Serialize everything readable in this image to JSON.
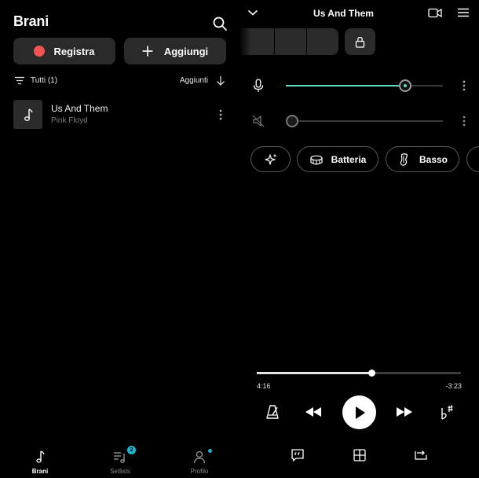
{
  "left": {
    "title": "Brani",
    "record_label": "Registra",
    "add_label": "Aggiungi",
    "filter_label": "Tutti (1)",
    "sort_label": "Aggiunti",
    "songs": [
      {
        "title": "Us And Them",
        "artist": "Pink Floyd"
      }
    ],
    "nav": {
      "brani_label": "Brani",
      "setlists_label": "Setlists",
      "setlists_badge": "2",
      "profilo_label": "Profilo"
    }
  },
  "player": {
    "title": "Us And Them",
    "mic_level": 0.76,
    "muted_track_level": 0.04,
    "chips": {
      "drums_label": "Batteria",
      "bass_label": "Basso"
    },
    "position_fraction": 0.56,
    "time_elapsed": "4:16",
    "time_remaining": "-3:23"
  },
  "colors": {
    "accent": "#5ee0c0",
    "record": "#f25353",
    "badge": "#19b6d4",
    "surface": "#2b2b2b",
    "background": "#000000"
  },
  "icons": [
    "search-icon",
    "plus-icon",
    "filter-icon",
    "arrow-down-icon",
    "music-note-icon",
    "more-vert-icon",
    "chevron-down-icon",
    "video-camera-icon",
    "hamburger-menu-icon",
    "lock-icon",
    "microphone-icon",
    "muted-speaker-icon",
    "sparkle-icon",
    "drum-icon",
    "bass-guitar-icon",
    "metronome-icon",
    "rewind-icon",
    "play-icon",
    "fast-forward-icon",
    "key-transpose-icon",
    "lyrics-icon",
    "grid-icon",
    "loop-icon",
    "setlist-icon",
    "profile-icon"
  ]
}
